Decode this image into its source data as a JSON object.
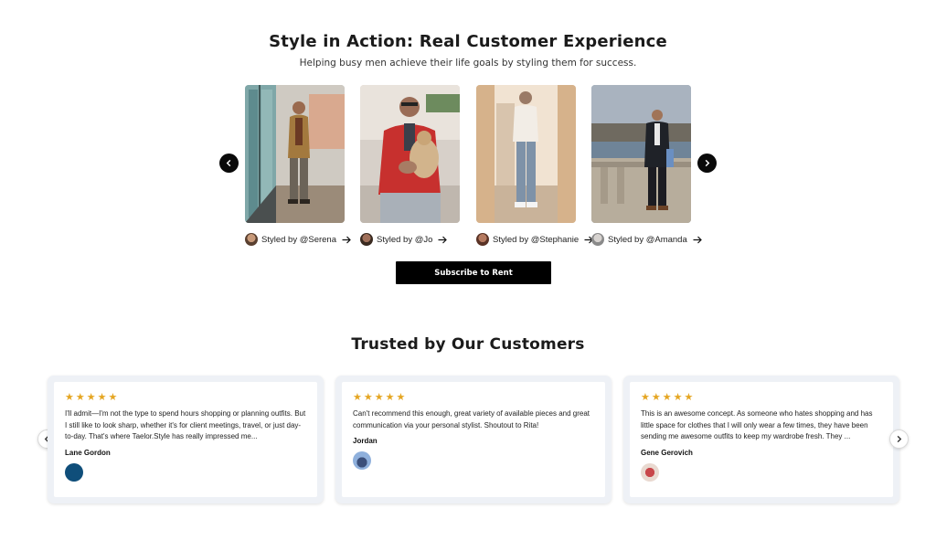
{
  "section1": {
    "title": "Style in Action: Real Customer Experience",
    "subtitle": "Helping busy men achieve their life goals by styling them for success.",
    "cards": [
      {
        "label": "Styled by @Serena"
      },
      {
        "label": "Styled by @Jo"
      },
      {
        "label": "Styled by @Stephanie"
      },
      {
        "label": "Styled by @Amanda"
      }
    ],
    "subscribe_label": "Subscribe to Rent"
  },
  "section2": {
    "title": "Trusted by Our Customers",
    "reviews": [
      {
        "stars": "★★★★★",
        "text": "I'll admit—I'm not the type to spend hours shopping or planning outfits. But I still like to look sharp, whether it's for client meetings, travel, or just day-to-day. That's where Taelor.Style has really impressed me...",
        "name": "Lane Gordon"
      },
      {
        "stars": "★★★★★",
        "text": "Can't recommend this enough, great variety of available pieces and great communication via your personal stylist. Shoutout to Rita!",
        "name": "Jordan"
      },
      {
        "stars": "★★★★★",
        "text": "This is an awesome concept. As someone who hates shopping and has little space for clothes that I will only wear a few times, they have been sending me awesome outfits to keep my wardrobe fresh. They ...",
        "name": "Gene Gerovich"
      }
    ]
  },
  "colors": {
    "star": "#e5a623",
    "button_bg": "#000000",
    "card_frame": "#eef1f6"
  },
  "icons": {
    "carousel_prev": "chevron-left-icon",
    "carousel_next": "chevron-right-icon",
    "link_arrow": "arrow-right-icon"
  }
}
